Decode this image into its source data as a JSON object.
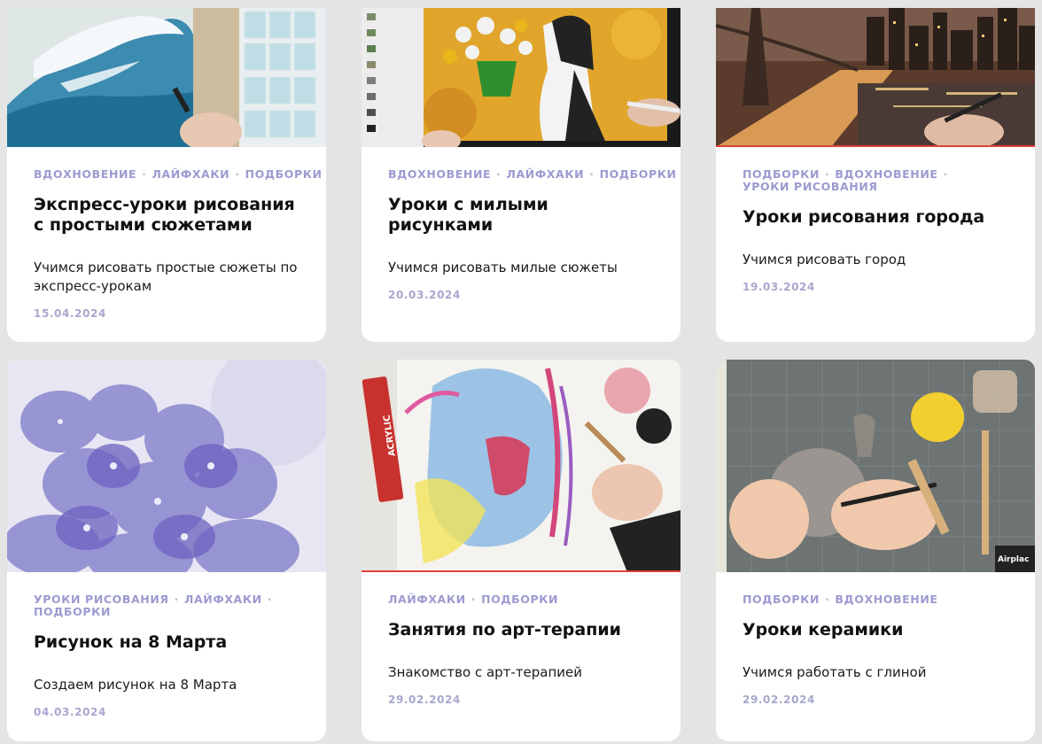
{
  "cards": [
    {
      "tags": [
        "ВДОХНОВЕНИЕ",
        "ЛАЙФХАКИ",
        "ПОДБОРКИ"
      ],
      "title": "Экспресс-уроки рисования с простыми сюжетами",
      "description": "Учимся рисовать простые сюжеты по экспресс-урокам",
      "date": "15.04.2024",
      "image": "watercolor-wave-image"
    },
    {
      "tags": [
        "ВДОХНОВЕНИЕ",
        "ЛАЙФХАКИ",
        "ПОДБОРКИ"
      ],
      "title": "Уроки с милыми рисунками",
      "description": "Учимся рисовать милые сюжеты",
      "date": "20.03.2024",
      "image": "dog-and-flowers-image"
    },
    {
      "tags": [
        "ПОДБОРКИ",
        "ВДОХНОВЕНИЕ",
        "УРОКИ РИСОВАНИЯ"
      ],
      "title": "Уроки рисования города",
      "description": "Учимся рисовать город",
      "date": "19.03.2024",
      "image": "city-bridge-image"
    },
    {
      "tags": [
        "УРОКИ РИСОВАНИЯ",
        "ЛАЙФХАКИ",
        "ПОДБОРКИ"
      ],
      "title": "Рисунок на 8 Марта",
      "description": "Создаем рисунок на 8 Марта",
      "date": "04.03.2024",
      "image": "hydrangea-image"
    },
    {
      "tags": [
        "ЛАЙФХАКИ",
        "ПОДБОРКИ"
      ],
      "title": "Занятия по арт-терапии",
      "description": "Знакомство с арт-терапией",
      "date": "29.02.2024",
      "image": "abstract-face-painting-image",
      "thumb_labels": {
        "acrylic_tube": "ACRYLIC"
      }
    },
    {
      "tags": [
        "ПОДБОРКИ",
        "ВДОХНОВЕНИЕ"
      ],
      "title": "Уроки керамики",
      "description": "Учимся работать с глиной",
      "date": "29.02.2024",
      "image": "ceramics-clay-image",
      "thumb_labels": {
        "clay_pack": "Airplac"
      }
    }
  ],
  "colors": {
    "page_bg": "#e4e4e4",
    "card_bg": "#ffffff",
    "tag": "#9b9bd0",
    "date": "#a7a7cf",
    "title": "#111111"
  }
}
